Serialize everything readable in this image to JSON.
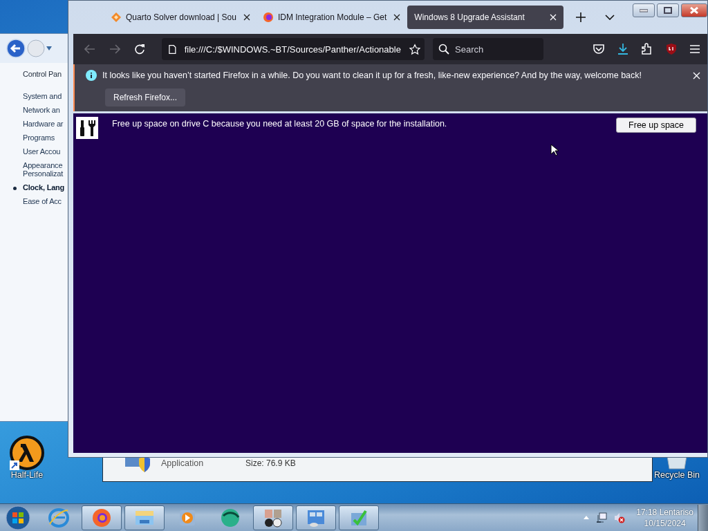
{
  "control_panel": {
    "title": "Control Pan",
    "items": [
      {
        "label": "System and",
        "selected": false
      },
      {
        "label": "Network an",
        "selected": false
      },
      {
        "label": "Hardware ar",
        "selected": false
      },
      {
        "label": "Programs",
        "selected": false
      },
      {
        "label": "User Accou",
        "selected": false
      },
      {
        "lines": [
          "Appearance",
          "Personalizat"
        ],
        "selected": false
      },
      {
        "label": "Clock, Lang",
        "selected": true
      },
      {
        "label": "Ease of Acc",
        "selected": false
      }
    ]
  },
  "file_window": {
    "type": "Application",
    "size": "Size: 76.9 KB"
  },
  "desktop_icons": [
    {
      "kind": "lambda",
      "label": "Half-Life"
    },
    {
      "kind": "bin",
      "label": "Recycle Bin"
    }
  ],
  "browser": {
    "tabs": [
      {
        "kind": "diamond",
        "title": "Quarto Solver download | Sou",
        "selected": false
      },
      {
        "kind": "firefox",
        "title": "IDM Integration Module – Get",
        "selected": false
      },
      {
        "kind": "none",
        "title": "Windows 8 Upgrade Assistant",
        "selected": true
      }
    ],
    "url": "file:///C:/$WINDOWS.~BT/Sources/Panther/Actionable",
    "search": {
      "placeholder": "Search"
    },
    "notification": {
      "message": "It looks like you haven’t started Firefox in a while. Do you want to clean it up for a fresh, like-new experience? And by the way, welcome back!",
      "button": "Refresh Firefox..."
    },
    "content": {
      "message": "Free up space on drive C because you need at least 20 GB of space for the installation.",
      "button": "Free up space"
    }
  },
  "taskbar": {
    "apps": [
      {
        "kind": "ie",
        "running": false
      },
      {
        "kind": "firefox",
        "running": true
      },
      {
        "kind": "folder",
        "running": true
      },
      {
        "kind": "media",
        "running": false
      },
      {
        "kind": "globe",
        "running": false
      },
      {
        "kind": "people",
        "running": true
      },
      {
        "kind": "panel",
        "running": true
      },
      {
        "kind": "check",
        "running": true
      }
    ],
    "time": "17:18 Lentariso",
    "date": "10/15/2024"
  }
}
